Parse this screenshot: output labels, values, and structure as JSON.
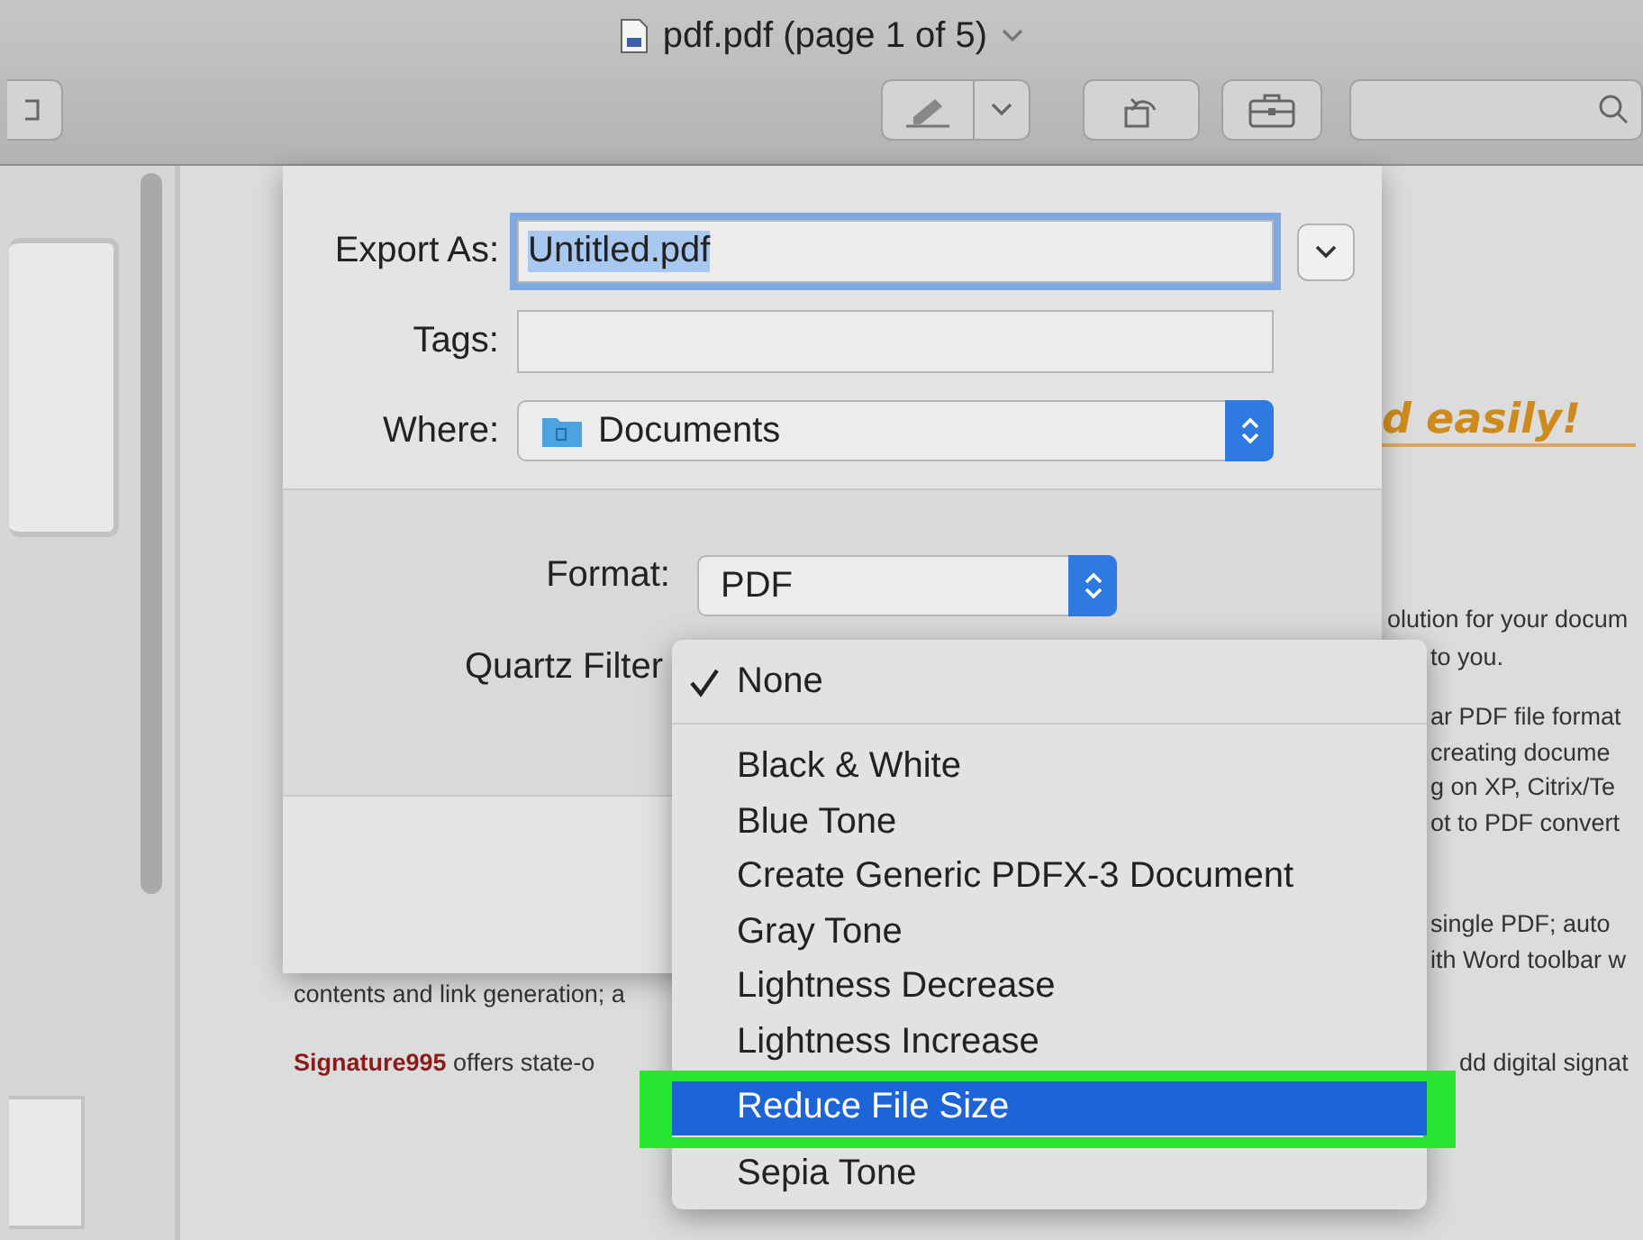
{
  "window": {
    "title": "pdf.pdf (page 1 of 5)"
  },
  "document": {
    "heading": "d easily!",
    "lines": [
      {
        "text": "olution for your docum"
      },
      {
        "text": "to you."
      },
      {
        "text": "ar PDF file format"
      },
      {
        "text": "creating docume"
      },
      {
        "text": "g on XP, Citrix/Te"
      },
      {
        "text": "ot to PDF convert"
      },
      {
        "text": "single PDF; auto"
      },
      {
        "text": "ith Word toolbar w"
      },
      {
        "text": "contents and link generation; a"
      },
      {
        "text": "**Signature995** offers state-o"
      },
      {
        "text": "dd digital signat"
      }
    ]
  },
  "export_sheet": {
    "fields": [
      {
        "label": "Export As:",
        "kind": "text",
        "value": "Untitled.pdf",
        "selected": true
      },
      {
        "label": "Tags:",
        "kind": "text"
      },
      {
        "label": "Where:",
        "kind": "popup",
        "value": "Documents"
      }
    ],
    "format": {
      "label": "Format:",
      "value": "PDF"
    },
    "quartz_filter": {
      "label": "Quartz Filter"
    }
  },
  "quartz_filter_menu": {
    "items": [
      {
        "label": "None",
        "checked": true,
        "selected": false
      },
      {
        "label": "Black & White",
        "checked": false,
        "selected": false
      },
      {
        "label": "Blue Tone",
        "checked": false,
        "selected": false
      },
      {
        "label": "Create Generic PDFX-3 Document",
        "checked": false,
        "selected": false
      },
      {
        "label": "Gray Tone",
        "checked": false,
        "selected": false
      },
      {
        "label": "Lightness Decrease",
        "checked": false,
        "selected": false
      },
      {
        "label": "Lightness Increase",
        "checked": false,
        "selected": false
      },
      {
        "label": "Reduce File Size",
        "checked": false,
        "selected": true
      },
      {
        "label": "Sepia Tone",
        "checked": false,
        "selected": false
      }
    ]
  }
}
